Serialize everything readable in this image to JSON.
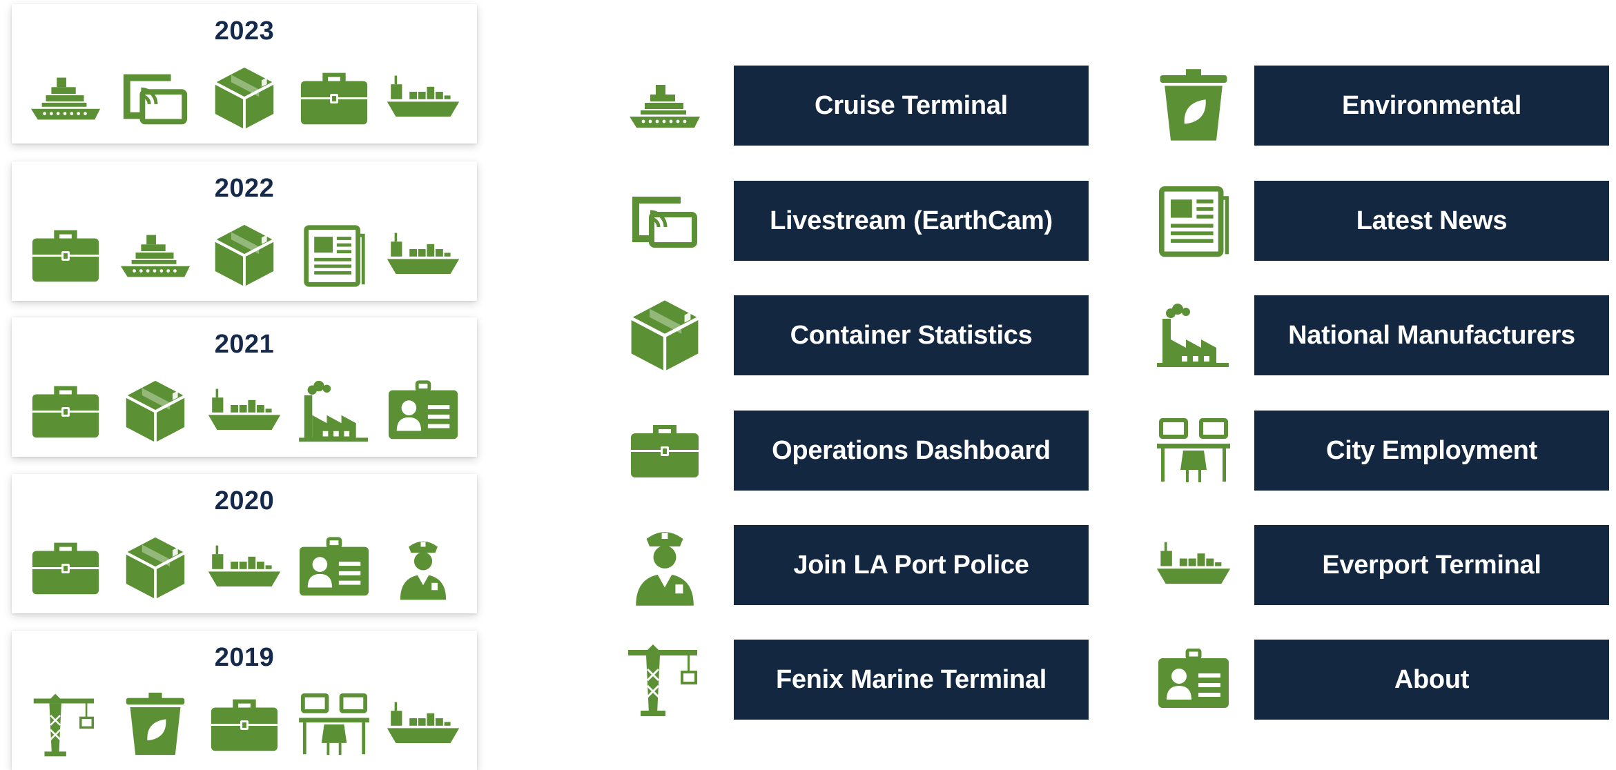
{
  "colors": {
    "icon_green": "#5b9134",
    "button_navy": "#132741",
    "text_dark": "#15294a"
  },
  "years": [
    {
      "label": "2023",
      "icons": [
        "cruise-ship",
        "livestream",
        "container",
        "briefcase",
        "cargo-ship"
      ]
    },
    {
      "label": "2022",
      "icons": [
        "briefcase",
        "cruise-ship",
        "container",
        "newspaper",
        "cargo-ship"
      ]
    },
    {
      "label": "2021",
      "icons": [
        "briefcase",
        "container",
        "cargo-ship",
        "factory",
        "id-card"
      ]
    },
    {
      "label": "2020",
      "icons": [
        "briefcase",
        "container",
        "cargo-ship",
        "id-card",
        "police-officer"
      ]
    },
    {
      "label": "2019",
      "icons": [
        "crane",
        "recycle-bin",
        "briefcase",
        "workstations",
        "cargo-ship"
      ]
    }
  ],
  "links_left": [
    {
      "label": "Cruise Terminal",
      "icon": "cruise-ship"
    },
    {
      "label": "Livestream (EarthCam)",
      "icon": "livestream"
    },
    {
      "label": "Container Statistics",
      "icon": "container"
    },
    {
      "label": "Operations Dashboard",
      "icon": "briefcase"
    },
    {
      "label": "Join LA Port Police",
      "icon": "police-officer"
    },
    {
      "label": "Fenix Marine Terminal",
      "icon": "crane"
    }
  ],
  "links_right": [
    {
      "label": "Environmental",
      "icon": "recycle-bin"
    },
    {
      "label": "Latest News",
      "icon": "newspaper"
    },
    {
      "label": "National Manufacturers",
      "icon": "factory"
    },
    {
      "label": "City Employment",
      "icon": "workstations"
    },
    {
      "label": "Everport Terminal",
      "icon": "cargo-ship"
    },
    {
      "label": "About",
      "icon": "id-card"
    }
  ]
}
